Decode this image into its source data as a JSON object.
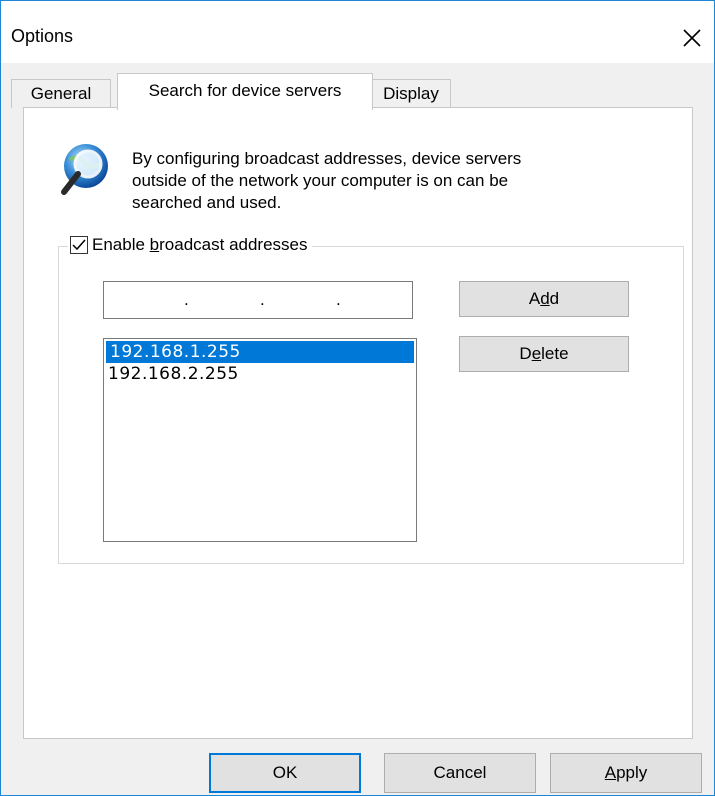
{
  "window": {
    "title": "Options",
    "close_icon": "close-icon"
  },
  "tabs": [
    {
      "label": "General",
      "active": false
    },
    {
      "label": "Search for device servers",
      "active": true
    },
    {
      "label": "Display",
      "active": false
    }
  ],
  "info": {
    "icon": "magnifier-globe-icon",
    "text_line1": "By configuring broadcast addresses, device servers",
    "text_line2": "outside of the network your computer is on can be",
    "text_line3": "searched and used."
  },
  "broadcast": {
    "checkbox_checked": true,
    "label_prefix": "Enable ",
    "label_accel": "b",
    "label_suffix": "roadcast addresses",
    "ip_input_dots": [
      ".",
      ".",
      "."
    ],
    "add_prefix": "A",
    "add_accel": "d",
    "add_suffix": "d",
    "delete_prefix": "D",
    "delete_accel": "e",
    "delete_suffix": "lete",
    "addresses": [
      "192.168.1.255",
      "192.168.2.255"
    ],
    "selected_index": 0
  },
  "footer": {
    "ok_label": "OK",
    "cancel_label": "Cancel",
    "apply_accel": "A",
    "apply_suffix": "pply"
  },
  "colors": {
    "selection": "#0078d7",
    "window_border": "#1e86d6"
  }
}
